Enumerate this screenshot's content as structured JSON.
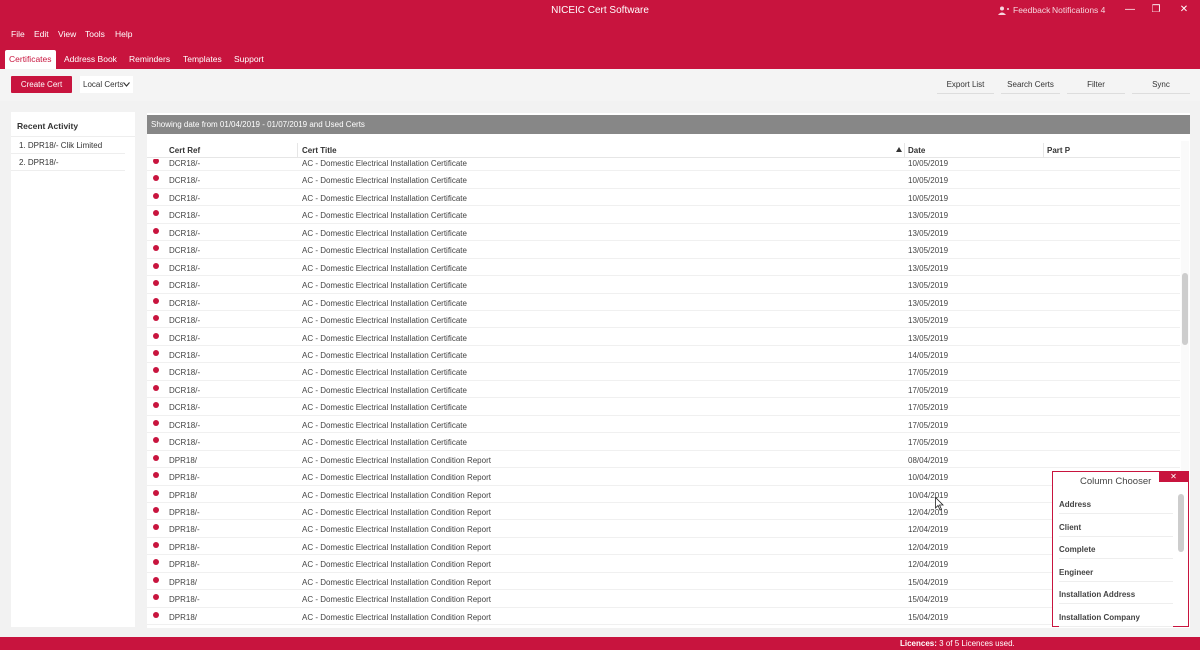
{
  "window": {
    "title": "NICEIC Cert Software",
    "feedback": "Feedback",
    "notifications": "Notifications 4",
    "minimize": "—",
    "restore": "❐",
    "close": "✕"
  },
  "menu": [
    "File",
    "Edit",
    "View",
    "Tools",
    "Help"
  ],
  "tabs": [
    "Certificates",
    "Address Book",
    "Reminders",
    "Templates",
    "Support"
  ],
  "toolbar": {
    "create": "Create Cert",
    "local": "Local Certs",
    "export": "Export List",
    "search": "Search Certs",
    "filter": "Filter",
    "sync": "Sync"
  },
  "sidebar": {
    "title": "Recent Activity",
    "items": [
      "1. DPR18/- Clik Limited",
      "2. DPR18/-"
    ]
  },
  "info": "Showing date from 01/04/2019 - 01/07/2019 and Used Certs",
  "columns": {
    "ref": "Cert Ref",
    "title": "Cert Title",
    "date": "Date",
    "part": "Part P"
  },
  "rows": [
    [
      "DCR18/-",
      "AC - Domestic Electrical Installation Certificate",
      "10/05/2019"
    ],
    [
      "DCR18/-",
      "AC - Domestic Electrical Installation Certificate",
      "10/05/2019"
    ],
    [
      "DCR18/-",
      "AC - Domestic Electrical Installation Certificate",
      "10/05/2019"
    ],
    [
      "DCR18/-",
      "AC - Domestic Electrical Installation Certificate",
      "13/05/2019"
    ],
    [
      "DCR18/-",
      "AC - Domestic Electrical Installation Certificate",
      "13/05/2019"
    ],
    [
      "DCR18/-",
      "AC - Domestic Electrical Installation Certificate",
      "13/05/2019"
    ],
    [
      "DCR18/-",
      "AC - Domestic Electrical Installation Certificate",
      "13/05/2019"
    ],
    [
      "DCR18/-",
      "AC - Domestic Electrical Installation Certificate",
      "13/05/2019"
    ],
    [
      "DCR18/-",
      "AC - Domestic Electrical Installation Certificate",
      "13/05/2019"
    ],
    [
      "DCR18/-",
      "AC - Domestic Electrical Installation Certificate",
      "13/05/2019"
    ],
    [
      "DCR18/-",
      "AC - Domestic Electrical Installation Certificate",
      "13/05/2019"
    ],
    [
      "DCR18/-",
      "AC - Domestic Electrical Installation Certificate",
      "14/05/2019"
    ],
    [
      "DCR18/-",
      "AC - Domestic Electrical Installation Certificate",
      "17/05/2019"
    ],
    [
      "DCR18/-",
      "AC - Domestic Electrical Installation Certificate",
      "17/05/2019"
    ],
    [
      "DCR18/-",
      "AC - Domestic Electrical Installation Certificate",
      "17/05/2019"
    ],
    [
      "DCR18/-",
      "AC - Domestic Electrical Installation Certificate",
      "17/05/2019"
    ],
    [
      "DCR18/-",
      "AC - Domestic Electrical Installation Certificate",
      "17/05/2019"
    ],
    [
      "DPR18/",
      "AC - Domestic Electrical Installation Condition Report",
      "08/04/2019"
    ],
    [
      "DPR18/-",
      "AC - Domestic Electrical Installation Condition Report",
      "10/04/2019"
    ],
    [
      "DPR18/",
      "AC - Domestic Electrical Installation Condition Report",
      "10/04/2019"
    ],
    [
      "DPR18/-",
      "AC - Domestic Electrical Installation Condition Report",
      "12/04/2019"
    ],
    [
      "DPR18/-",
      "AC - Domestic Electrical Installation Condition Report",
      "12/04/2019"
    ],
    [
      "DPR18/-",
      "AC - Domestic Electrical Installation Condition Report",
      "12/04/2019"
    ],
    [
      "DPR18/-",
      "AC - Domestic Electrical Installation Condition Report",
      "12/04/2019"
    ],
    [
      "DPR18/",
      "AC - Domestic Electrical Installation Condition Report",
      "15/04/2019"
    ],
    [
      "DPR18/-",
      "AC - Domestic Electrical Installation Condition Report",
      "15/04/2019"
    ],
    [
      "DPR18/",
      "AC - Domestic Electrical Installation Condition Report",
      "15/04/2019"
    ]
  ],
  "chooser": {
    "title": "Column Chooser",
    "close": "✕",
    "items": [
      "Address",
      "Client",
      "Complete",
      "Engineer",
      "Installation Address",
      "Installation Company"
    ]
  },
  "status": {
    "label": "Licences:",
    "value": "3 of 5 Licences used."
  },
  "colors": {
    "brand": "#c8143e",
    "infobar": "#878787"
  }
}
